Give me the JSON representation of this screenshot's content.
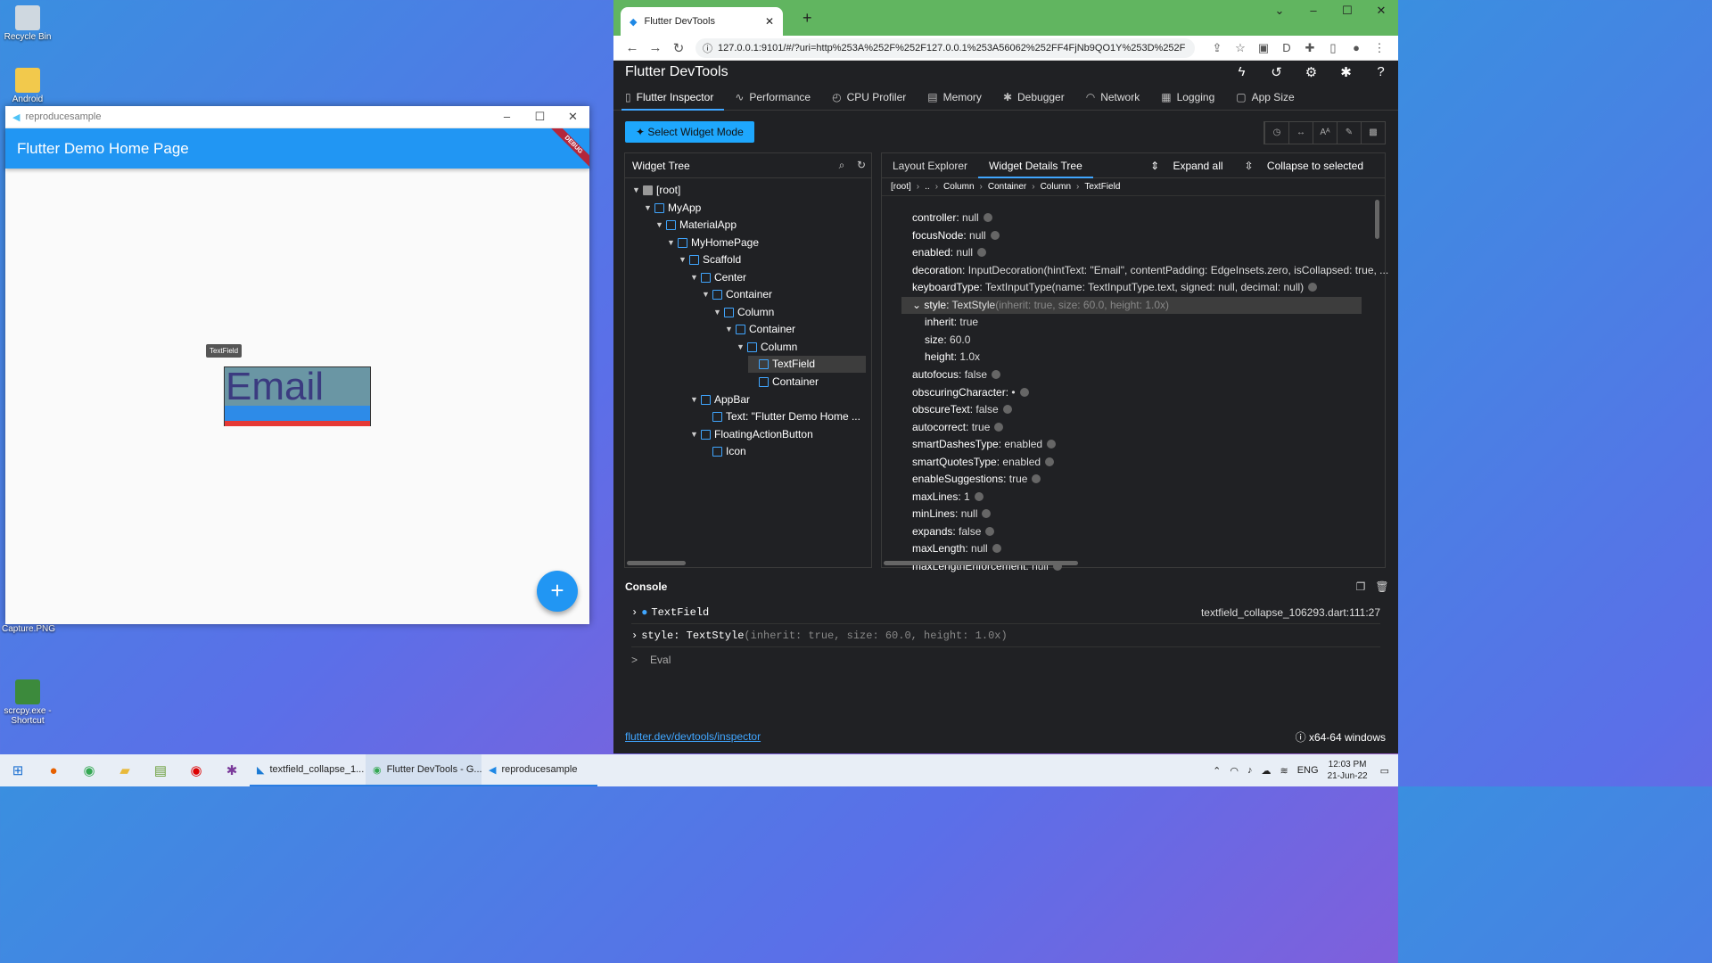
{
  "desktop": {
    "icons": [
      {
        "label": "Recycle Bin",
        "icon": "recycle-bin-icon"
      },
      {
        "label": "Android",
        "icon": "folder-icon"
      },
      {
        "label": "Capture.PNG",
        "icon": "image-file-icon"
      },
      {
        "label": "scrcpy.exe - Shortcut",
        "icon": "shortcut-icon"
      }
    ]
  },
  "app_window": {
    "title": "reproducesample",
    "appbar_title": "Flutter Demo Home Page",
    "debug_banner": "DEBUG",
    "textfield_value": "Email",
    "tooltip": "TextField",
    "fab_label": "+"
  },
  "browser": {
    "tab_title": "Flutter DevTools",
    "url": "127.0.0.1:9101/#/?uri=http%253A%252F%252F127.0.0.1%253A56062%252FF4FjNb9QO1Y%253D%252F"
  },
  "devtools": {
    "title": "Flutter DevTools",
    "tabs": [
      {
        "label": "Flutter Inspector",
        "icon": "phone-icon"
      },
      {
        "label": "Performance",
        "icon": "chart-icon"
      },
      {
        "label": "CPU Profiler",
        "icon": "timer-icon"
      },
      {
        "label": "Memory",
        "icon": "memory-icon"
      },
      {
        "label": "Debugger",
        "icon": "bug-icon"
      },
      {
        "label": "Network",
        "icon": "wifi-icon"
      },
      {
        "label": "Logging",
        "icon": "log-icon"
      },
      {
        "label": "App Size",
        "icon": "file-icon"
      }
    ],
    "select_widget_mode": "Select Widget Mode",
    "widget_tree_title": "Widget Tree",
    "tree": [
      {
        "label": "[root]",
        "depth": 0
      },
      {
        "label": "MyApp",
        "depth": 1
      },
      {
        "label": "MaterialApp",
        "depth": 2
      },
      {
        "label": "MyHomePage",
        "depth": 3
      },
      {
        "label": "Scaffold",
        "depth": 4
      },
      {
        "label": "Center",
        "depth": 5
      },
      {
        "label": "Container",
        "depth": 6
      },
      {
        "label": "Column",
        "depth": 7
      },
      {
        "label": "Container",
        "depth": 8
      },
      {
        "label": "Column",
        "depth": 9
      },
      {
        "label": "TextField",
        "depth": 10
      },
      {
        "label": "Container",
        "depth": 10
      },
      {
        "label": "AppBar",
        "depth": 5
      },
      {
        "label": "Text: \"Flutter Demo Home ...",
        "depth": 6
      },
      {
        "label": "FloatingActionButton",
        "depth": 5
      },
      {
        "label": "Icon",
        "depth": 6
      }
    ],
    "details_tabs": [
      "Layout Explorer",
      "Widget Details Tree"
    ],
    "expand_all": "Expand all",
    "collapse_to_selected": "Collapse to selected",
    "breadcrumbs": [
      "[root]",
      "..",
      "Column",
      "Container",
      "Column",
      "TextField"
    ],
    "properties": [
      {
        "key": "controller",
        "value": "null"
      },
      {
        "key": "focusNode",
        "value": "null"
      },
      {
        "key": "enabled",
        "value": "null"
      },
      {
        "key": "decoration",
        "value": "InputDecoration(hintText: \"Email\", contentPadding: EdgeInsets.zero, isCollapsed: true, ..."
      },
      {
        "key": "keyboardType",
        "value": "TextInputType(name: TextInputType.text, signed: null, decimal: null)"
      },
      {
        "key": "style",
        "value": "TextStyle",
        "extra": "(inherit: true, size: 60.0, height: 1.0x)"
      },
      {
        "key": "inherit",
        "value": "true"
      },
      {
        "key": "size",
        "value": "60.0"
      },
      {
        "key": "height",
        "value": "1.0x"
      },
      {
        "key": "autofocus",
        "value": "false"
      },
      {
        "key": "obscuringCharacter",
        "value": "•"
      },
      {
        "key": "obscureText",
        "value": "false"
      },
      {
        "key": "autocorrect",
        "value": "true"
      },
      {
        "key": "smartDashesType",
        "value": "enabled"
      },
      {
        "key": "smartQuotesType",
        "value": "enabled"
      },
      {
        "key": "enableSuggestions",
        "value": "true"
      },
      {
        "key": "maxLines",
        "value": "1"
      },
      {
        "key": "minLines",
        "value": "null"
      },
      {
        "key": "expands",
        "value": "false"
      },
      {
        "key": "maxLength",
        "value": "null"
      },
      {
        "key": "maxLengthEnforcement",
        "value": "null"
      }
    ],
    "console": {
      "title": "Console",
      "rows": [
        {
          "text": "TextField",
          "loc": "textfield_collapse_106293.dart:111:27"
        },
        {
          "text": "style: TextStyle",
          "extra": "(inherit: true, size: 60.0, height: 1.0x)",
          "loc": ""
        }
      ],
      "eval_placeholder": "Eval"
    },
    "footer_link": "flutter.dev/devtools/inspector",
    "platform": "x64-64 windows"
  },
  "taskbar": {
    "apps": [
      {
        "label": "textfield_collapse_1..."
      },
      {
        "label": "Flutter DevTools - G..."
      },
      {
        "label": "reproducesample"
      }
    ],
    "language": "ENG",
    "time": "12:03 PM",
    "date": "21-Jun-22"
  },
  "colors": {
    "accent": "#40a6ff",
    "appbar": "#2196f3",
    "tabstrip": "#61b560"
  }
}
